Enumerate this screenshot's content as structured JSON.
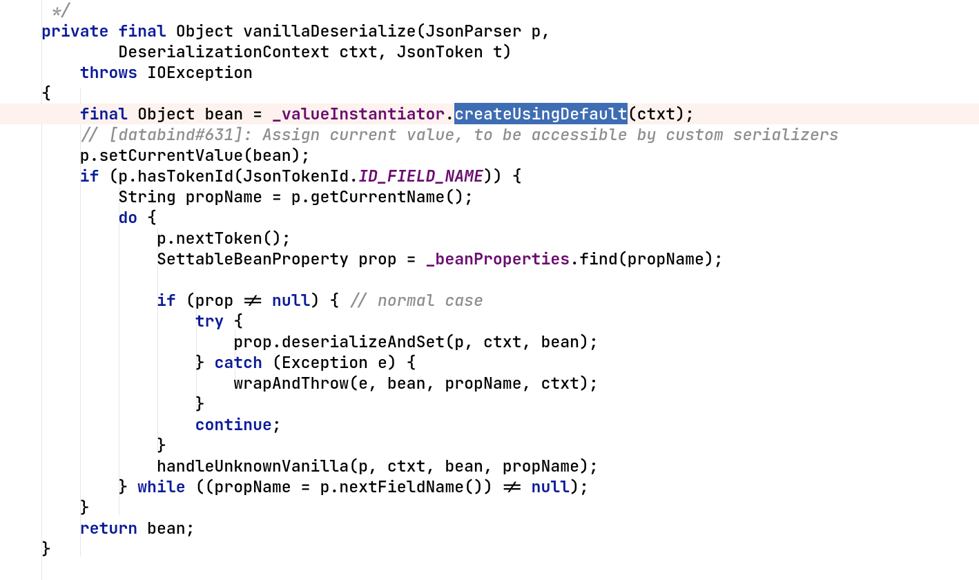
{
  "editor": {
    "highlighted_line_index": 5,
    "selection": {
      "line_index": 5,
      "text": "createUsingDefault"
    }
  },
  "tokens": {
    "kw_private": "private",
    "kw_final": "final",
    "kw_throws": "throws",
    "kw_if": "if",
    "kw_do": "do",
    "kw_null": "null",
    "kw_try": "try",
    "kw_catch": "catch",
    "kw_continue": "continue",
    "kw_while": "while",
    "kw_return": "return",
    "field_valueInstantiator": "_valueInstantiator",
    "field_beanProperties": "_beanProperties",
    "const_ID_FIELD_NAME": "ID_FIELD_NAME",
    "sel_createUsingDefault": "createUsingDefault"
  },
  "plain": {
    "l0": " */",
    "l1a": " Object vanillaDeserialize(JsonParser p,",
    "l2": "        DeserializationContext ctxt, JsonToken t)",
    "l3b": " IOException",
    "l4": "{",
    "l5a": " Object bean = ",
    "l5c": "(ctxt);",
    "l5dot": ".",
    "l6": "    // [databind#631]: Assign current value, to be accessible by custom serializers",
    "l7": "    p.setCurrentValue(bean);",
    "l8a": " (p.hasTokenId(JsonTokenId.",
    "l8b": ")) {",
    "l9": "        String propName = p.getCurrentName();",
    "l10b": " {",
    "l11": "            p.nextToken();",
    "l12a": "            SettableBeanProperty prop = ",
    "l12b": ".find(propName);",
    "l14a": " (prop != ",
    "l14b": ") { ",
    "l14c": "// normal case",
    "l15b": " {",
    "l16": "                    prop.deserializeAndSet(p, ctxt, bean);",
    "l17a": "                } ",
    "l17b": " (Exception e) {",
    "l18": "                    wrapAndThrow(e, bean, propName, ctxt);",
    "l19": "                }",
    "l20b": ";",
    "l21": "            }",
    "l22": "            handleUnknownVanilla(p, ctxt, bean, propName);",
    "l23a": "        } ",
    "l23b": " ((propName = p.nextFieldName()) != ",
    "l23c": ");",
    "l24": "    }",
    "l25b": " bean;",
    "l26": "}"
  },
  "indent": {
    "i4": "    ",
    "i8": "        ",
    "i12": "            ",
    "i16": "                "
  }
}
